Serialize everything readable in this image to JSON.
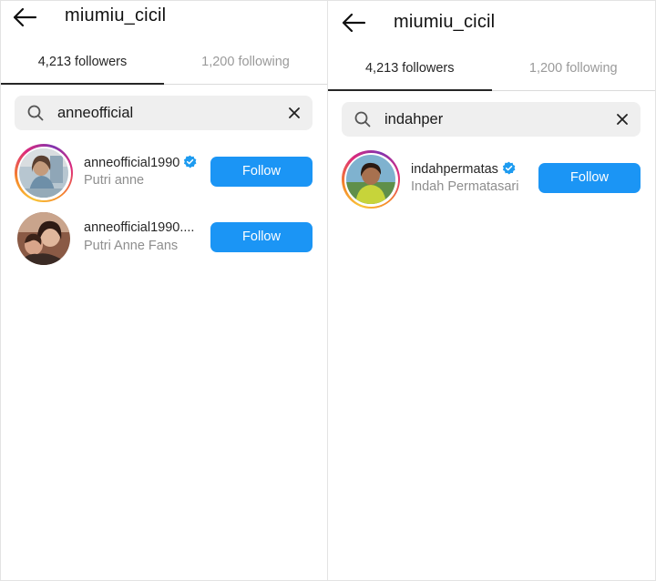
{
  "colors": {
    "accent": "#1b95f5",
    "verified": "#1d9bf0"
  },
  "left": {
    "header": {
      "title": "miumiu_cicil",
      "back_icon": "arrow-left-icon"
    },
    "tabs": {
      "followers": "4,213 followers",
      "following": "1,200 following",
      "active": "followers"
    },
    "search": {
      "value": "anneofficial"
    },
    "results": [
      {
        "username": "anneofficial1990",
        "verified": true,
        "fullname": "Putri anne",
        "follow": "Follow",
        "story_ring": true
      },
      {
        "username": "anneofficial1990....",
        "verified": false,
        "fullname": "Putri Anne Fans",
        "follow": "Follow",
        "story_ring": false
      }
    ]
  },
  "right": {
    "header": {
      "title": "miumiu_cicil",
      "back_icon": "arrow-left-icon"
    },
    "tabs": {
      "followers": "4,213 followers",
      "following": "1,200 following",
      "active": "followers"
    },
    "search": {
      "value": "indahper"
    },
    "results": [
      {
        "username": "indahpermatas",
        "verified": true,
        "fullname": "Indah Permatasari",
        "follow": "Follow",
        "story_ring": true
      }
    ]
  }
}
